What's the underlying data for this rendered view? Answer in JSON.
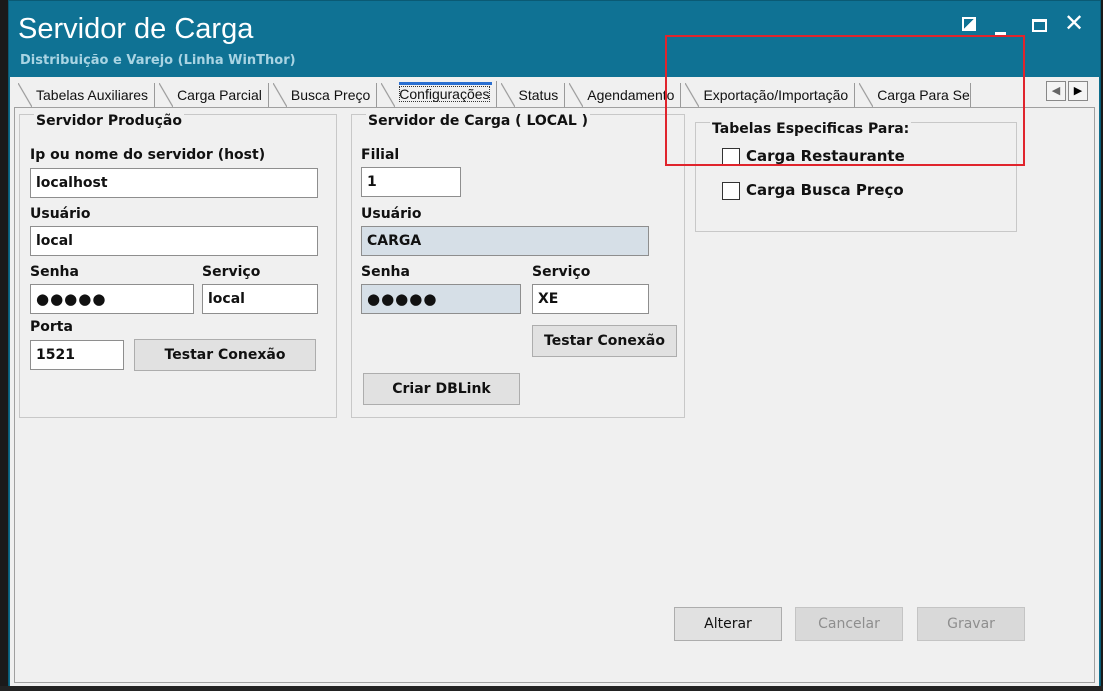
{
  "window": {
    "title": "Servidor de Carga",
    "subtitle": "Distribuição e Varejo (Linha WinThor)",
    "controls": {
      "restore": "restore",
      "minimize": "minimize",
      "maximize": "maximize",
      "close": "✕"
    }
  },
  "tabs": [
    {
      "label": "Tabelas Auxiliares"
    },
    {
      "label": "Carga Parcial"
    },
    {
      "label": "Busca Preço"
    },
    {
      "label": "Configurações",
      "active": true
    },
    {
      "label": "Status"
    },
    {
      "label": "Agendamento"
    },
    {
      "label": "Exportação/Importação"
    },
    {
      "label": "Carga Para Ser"
    }
  ],
  "tab_scroll": {
    "left": "◀",
    "right": "▶"
  },
  "producao": {
    "title": "Servidor Produção",
    "host_label": "Ip ou nome do servidor (host)",
    "host_value": "localhost",
    "usuario_label": "Usuário",
    "usuario_value": "local",
    "senha_label": "Senha",
    "senha_value": "●●●●●",
    "servico_label": "Serviço",
    "servico_value": "local",
    "porta_label": "Porta",
    "porta_value": "1521",
    "testar_label": "Testar Conexão"
  },
  "carga": {
    "title": "Servidor de Carga ( LOCAL )",
    "filial_label": "Filial",
    "filial_value": "1",
    "usuario_label": "Usuário",
    "usuario_value": "CARGA",
    "senha_label": "Senha",
    "senha_value": "●●●●●",
    "servico_label": "Serviço",
    "servico_value": "XE",
    "testar_label": "Testar Conexão",
    "dblink_label": "Criar DBLink"
  },
  "especificas": {
    "title": "Tabelas Especificas Para:",
    "restaurante_label": "Carga Restaurante",
    "restaurante_checked": false,
    "buscapreco_label": "Carga Busca Preço",
    "buscapreco_checked": false
  },
  "actions": {
    "alterar": "Alterar",
    "cancelar": "Cancelar",
    "gravar": "Gravar"
  },
  "colors": {
    "titlebar": "#0f7294",
    "highlight": "#e0242c",
    "readonly_field": "#d6dfe7"
  }
}
